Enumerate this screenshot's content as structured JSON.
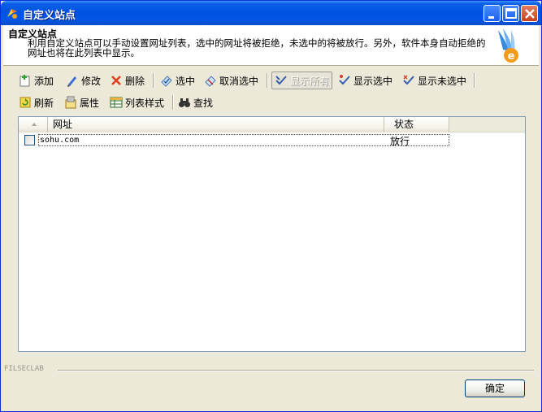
{
  "window": {
    "title": "自定义站点"
  },
  "header": {
    "title": "自定义站点",
    "description": "利用自定义站点可以手动设置网址列表，选中的网址将被拒绝，未选中的将被放行。另外，软件本身自动拒绝的网址也将在此列表中显示。"
  },
  "toolbar1": {
    "add": "添加",
    "edit": "修改",
    "delete": "删除",
    "select": "选中",
    "unselect": "取消选中",
    "show_all": "显示所有",
    "show_selected": "显示选中",
    "show_unselected": "显示未选中"
  },
  "toolbar2": {
    "refresh": "刷新",
    "properties": "属性",
    "list_style": "列表样式",
    "find": "查找"
  },
  "list": {
    "columns": [
      "网址",
      "状态"
    ],
    "rows": [
      {
        "url": "sohu.com",
        "status": "放行",
        "checked": false
      }
    ]
  },
  "footer": {
    "brand": "FILSECLAB",
    "ok_label": "确定"
  },
  "colors": {
    "title_bar": "#0053e1",
    "window_bg": "#ece9d8",
    "list_border": "#7f9db9"
  }
}
